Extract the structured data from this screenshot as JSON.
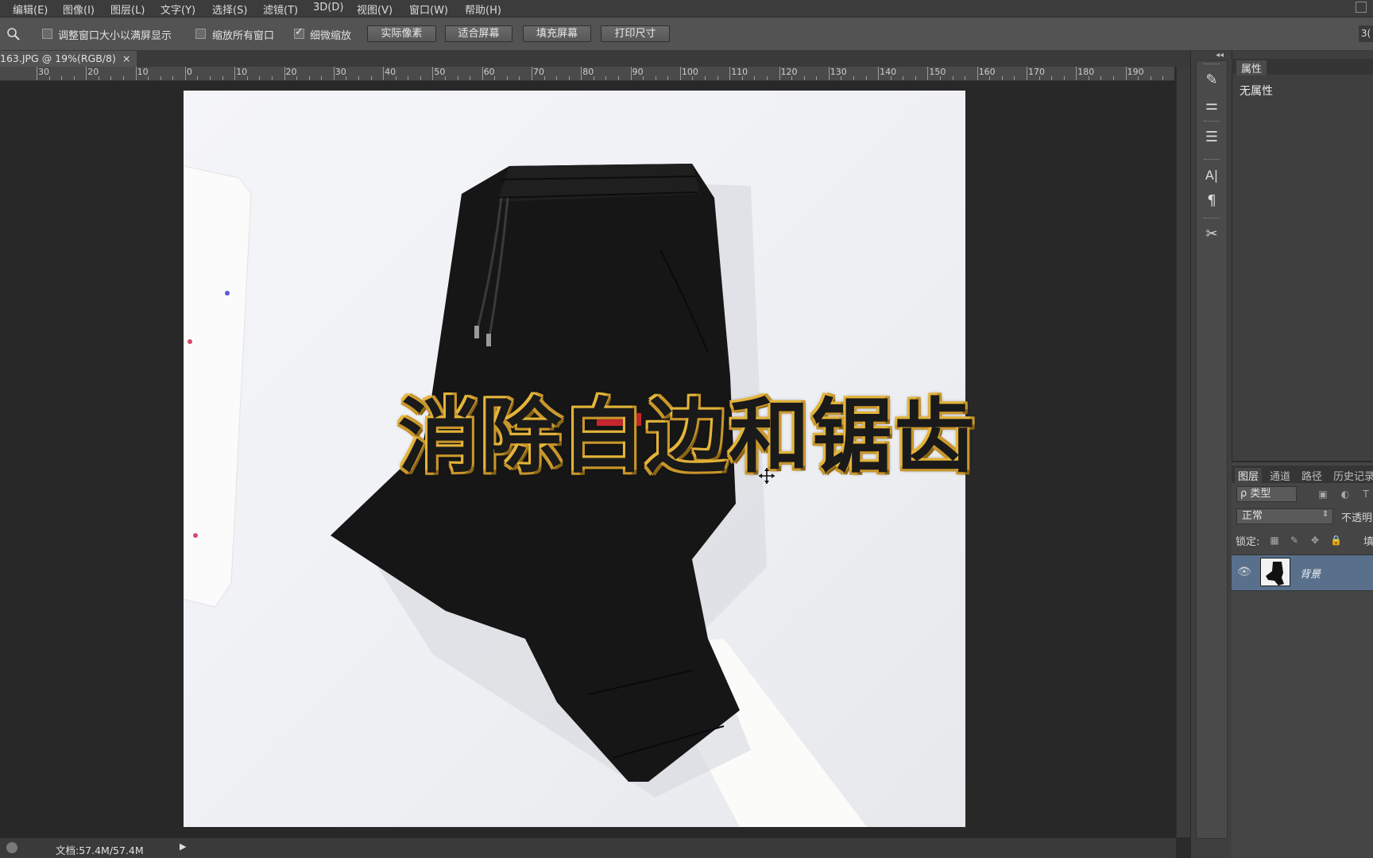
{
  "menu": [
    "编辑(E)",
    "图像(I)",
    "图层(L)",
    "文字(Y)",
    "选择(S)",
    "滤镜(T)",
    "3D(D)",
    "视图(V)",
    "窗口(W)",
    "帮助(H)"
  ],
  "options": {
    "resize_windows": {
      "label": "调整窗口大小以满屏显示",
      "checked": false
    },
    "zoom_all_windows": {
      "label": "缩放所有窗口",
      "checked": false
    },
    "scrubby_zoom": {
      "label": "细微缩放",
      "checked": true
    },
    "buttons": [
      "实际像素",
      "适合屏幕",
      "填充屏幕",
      "打印尺寸"
    ],
    "right_label": "3("
  },
  "document": {
    "tab_title": "163.JPG @ 19%(RGB/8)",
    "close": "×"
  },
  "ruler": {
    "labels": [
      "30",
      "20",
      "10",
      "0",
      "10",
      "20",
      "30",
      "40",
      "50",
      "60",
      "70",
      "80",
      "90",
      "100",
      "110",
      "120",
      "130",
      "140",
      "150",
      "160",
      "170",
      "180",
      "190"
    ]
  },
  "overlay_caption": "消除白边和锯齿",
  "status": {
    "doc_size": "文档:57.4M/57.4M",
    "arrow": "▶"
  },
  "tools": {
    "collapse": "◂◂",
    "icons": [
      "brush-settings-icon",
      "adjustment-icon",
      "clone-source-icon",
      "character-icon",
      "paragraph-icon",
      "tool-presets-icon"
    ],
    "glyphs": [
      "✎",
      "⚌",
      "☰",
      "A|",
      "¶",
      "✂"
    ]
  },
  "properties": {
    "tab": "属性",
    "value": "无属性"
  },
  "layers": {
    "tabs": [
      "图层",
      "通道",
      "路径",
      "历史记录"
    ],
    "filter_label": "ρ 类型",
    "blend_mode": "正常",
    "opacity_label": "不透明",
    "lock_label": "锁定:",
    "fill_label": "填",
    "items": [
      {
        "name": "背景",
        "visible": true
      }
    ]
  },
  "colors": {
    "accent_layer": "#59708d",
    "caption_gold": "#e4b43a"
  }
}
